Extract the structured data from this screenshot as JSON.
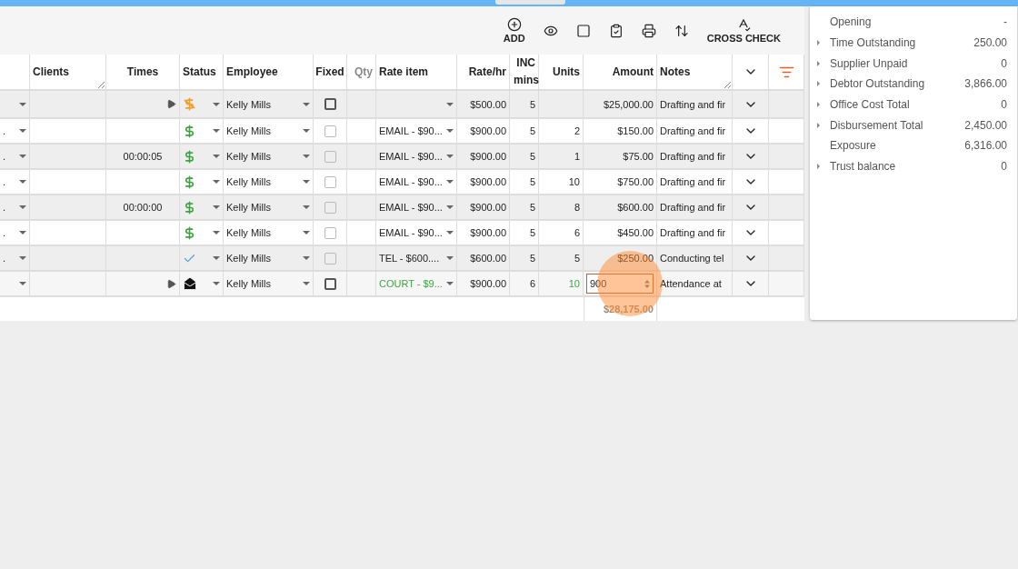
{
  "toolbar": [
    {
      "kind": "add",
      "label": "ADD"
    },
    {
      "kind": "view"
    },
    {
      "kind": "stop"
    },
    {
      "kind": "approve"
    },
    {
      "kind": "print"
    },
    {
      "kind": "sort"
    },
    {
      "kind": "cross_check",
      "label": "CROSS CHECK"
    }
  ],
  "columns": [
    {
      "label": "Clients",
      "resizable": true,
      "disabled": false
    },
    {
      "label": "Times",
      "resizable": false,
      "disabled": false
    },
    {
      "label": "Status",
      "resizable": false,
      "disabled": false
    },
    {
      "label": "Employee",
      "resizable": false,
      "disabled": false
    },
    {
      "label": "Fixed",
      "resizable": false,
      "disabled": false
    },
    {
      "label": "Qty",
      "resizable": false,
      "disabled": true
    },
    {
      "label": "Rate item",
      "resizable": false,
      "disabled": false
    },
    {
      "label": "Rate/hr",
      "resizable": false,
      "disabled": false
    },
    {
      "label": "INC mins",
      "resizable": false,
      "disabled": false
    },
    {
      "label": "Units",
      "resizable": false,
      "disabled": false
    },
    {
      "label": "Amount",
      "resizable": false,
      "disabled": false
    },
    {
      "label": "Notes",
      "resizable": true,
      "disabled": false
    }
  ],
  "rows": [
    {
      "play": true,
      "status": {
        "kind": "unbilled"
      },
      "employee": "Kelly Mills",
      "fixed": false,
      "fixed_disabled": false,
      "rate": "$500.00",
      "inc_mins": "5",
      "amount": "$25,000.00",
      "notes": "Drafting and fir"
    },
    {
      "column_1": ".",
      "status": {
        "kind": "billed"
      },
      "employee": "Kelly Mills",
      "fixed": false,
      "fixed_disabled": true,
      "rate_item": "EMAIL - $90...",
      "rate": "$900.00",
      "inc_mins": "5",
      "units": "2",
      "amount": "$150.00",
      "notes": "Drafting and fir"
    },
    {
      "column_1": ".",
      "times": "00:00:05",
      "status": {
        "kind": "billed"
      },
      "employee": "Kelly Mills",
      "fixed": false,
      "fixed_disabled": true,
      "rate_item": "EMAIL - $90...",
      "rate": "$900.00",
      "inc_mins": "5",
      "units": "1",
      "amount": "$75.00",
      "notes": "Drafting and fir"
    },
    {
      "column_1": ".",
      "status": {
        "kind": "billed"
      },
      "employee": "Kelly Mills",
      "fixed": false,
      "fixed_disabled": true,
      "rate_item": "EMAIL - $90...",
      "rate": "$900.00",
      "inc_mins": "5",
      "units": "10",
      "amount": "$750.00",
      "notes": "Drafting and fir"
    },
    {
      "column_1": ".",
      "times": "00:00:00",
      "status": {
        "kind": "billed"
      },
      "employee": "Kelly Mills",
      "fixed": false,
      "fixed_disabled": true,
      "rate_item": "EMAIL - $90...",
      "rate": "$900.00",
      "inc_mins": "5",
      "units": "8",
      "amount": "$600.00",
      "notes": "Drafting and fir"
    },
    {
      "column_1": ".",
      "status": {
        "kind": "billed"
      },
      "employee": "Kelly Mills",
      "fixed": false,
      "fixed_disabled": true,
      "rate_item": "EMAIL - $90...",
      "rate": "$900.00",
      "inc_mins": "5",
      "units": "6",
      "amount": "$450.00",
      "notes": "Drafting and fir"
    },
    {
      "column_1": ".",
      "status": {
        "kind": "done"
      },
      "employee": "Kelly Mills",
      "fixed": false,
      "fixed_disabled": true,
      "rate_item": "TEL - $600....",
      "rate": "$600.00",
      "inc_mins": "5",
      "units": "5",
      "amount": "$250.00",
      "notes": "Conducting tel"
    },
    {
      "play": true,
      "status": {
        "kind": "mail"
      },
      "employee": "Kelly Mills",
      "fixed": false,
      "fixed_disabled": false,
      "rate_item": "COURT - $9...",
      "highlight": true,
      "rate": "$900.00",
      "inc_mins": "6",
      "units": "10",
      "amount": "900",
      "editing": true,
      "clicked": true,
      "notes": "Attendance at"
    }
  ],
  "total": "$28,175.00",
  "summary": [
    {
      "label": "Opening",
      "value": "-",
      "expandable": false
    },
    {
      "label": "Time Outstanding",
      "value": "250.00",
      "expandable": true
    },
    {
      "label": "Supplier Unpaid",
      "value": "0",
      "expandable": true
    },
    {
      "label": "Debtor Outstanding",
      "value": "3,866.00",
      "expandable": true
    },
    {
      "label": "Office Cost Total",
      "value": "0",
      "expandable": true
    },
    {
      "label": "Disbursement Total",
      "value": "2,450.00",
      "expandable": true
    },
    {
      "label": "Exposure",
      "value": "6,316.00",
      "expandable": false
    },
    {
      "label": "Trust balance",
      "value": "0",
      "expandable": true
    }
  ]
}
